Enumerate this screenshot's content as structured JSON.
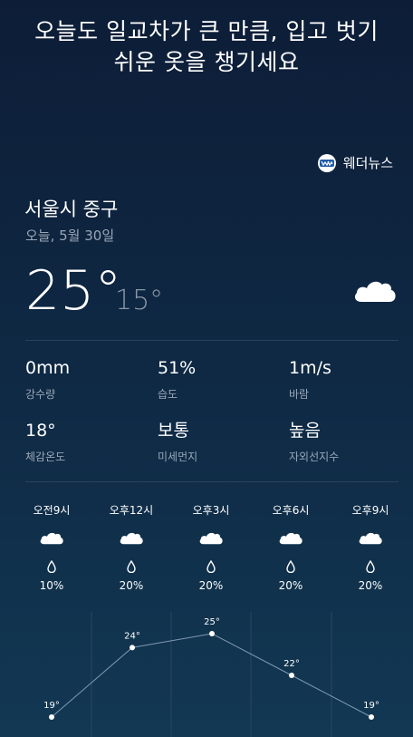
{
  "headline": {
    "line1": "오늘도 일교차가 큰 만큼, 입고 벗기",
    "line2": "쉬운 옷을 챙기세요"
  },
  "brand": {
    "name": "웨더뉴스",
    "logo_icon": "weathernews-logo-icon"
  },
  "location": "서울시 중구",
  "date": "오늘, 5월 30일",
  "current": {
    "temp": "25°",
    "low": "15°",
    "icon": "cloud-icon"
  },
  "stats": [
    {
      "value": "0mm",
      "label": "강수량"
    },
    {
      "value": "51%",
      "label": "습도"
    },
    {
      "value": "1m/s",
      "label": "바람"
    },
    {
      "value": "18°",
      "label": "체감온도"
    },
    {
      "value": "보통",
      "label": "미세먼지"
    },
    {
      "value": "높음",
      "label": "자외선지수"
    }
  ],
  "hourly": [
    {
      "time": "오전9시",
      "icon": "cloud-icon",
      "pop": "10%",
      "temp": "19°"
    },
    {
      "time": "오후12시",
      "icon": "cloud-icon",
      "pop": "20%",
      "temp": "24°"
    },
    {
      "time": "오후3시",
      "icon": "cloud-icon",
      "pop": "20%",
      "temp": "25°"
    },
    {
      "time": "오후6시",
      "icon": "cloud-icon",
      "pop": "20%",
      "temp": "22°"
    },
    {
      "time": "오후9시",
      "icon": "cloud-icon",
      "pop": "20%",
      "temp": "19°"
    }
  ],
  "chart_data": {
    "type": "line",
    "categories": [
      "오전9시",
      "오후12시",
      "오후3시",
      "오후6시",
      "오후9시"
    ],
    "values": [
      19,
      24,
      25,
      22,
      19
    ]
  },
  "colors": {
    "background_top": "#0d1d37",
    "background_bottom": "#123853",
    "muted_text": "#9aa7b6"
  }
}
